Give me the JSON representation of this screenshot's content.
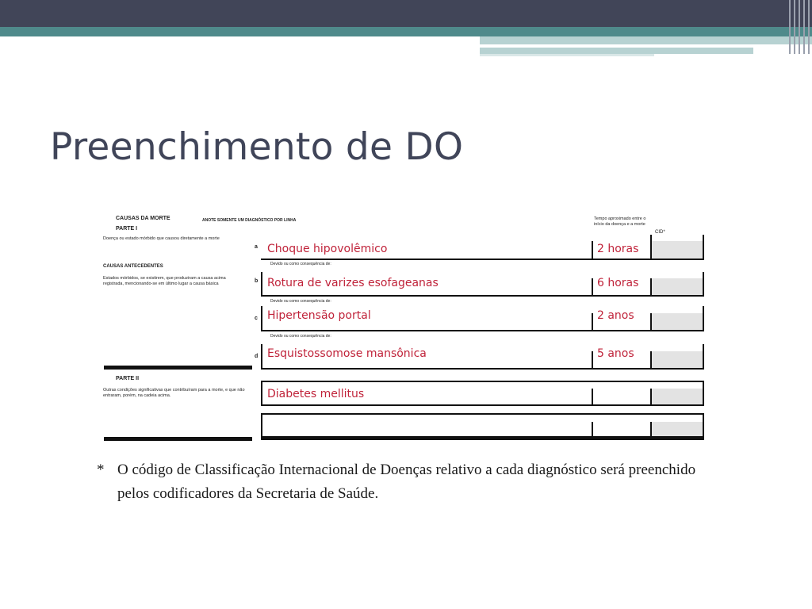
{
  "slide": {
    "title": "Preenchimento de DO"
  },
  "form": {
    "section_title": "CAUSAS DA MORTE",
    "section_note": "ANOTE SOMENTE UM DIAGNÓSTICO POR LINHA",
    "part1_label": "PARTE I",
    "part1_desc": "Doença ou estado mórbido que causou diretamente a morte",
    "antecedents_label": "CAUSAS ANTECEDENTES",
    "antecedents_desc": "Estados mórbidos, se existirem, que produziram a causa acima registrada, mencionando-se em último lugar a causa básica",
    "part2_label": "PARTE II",
    "part2_desc": "Outras condições significativas que contribuíram para a morte, e que não entraram, porém, na cadeia acima.",
    "time_header": "Tempo aproximado entre o início da doença e a morte",
    "cid_header": "CID*",
    "consequence_label": "Devido ou como consequência de:",
    "rows": [
      {
        "letter": "a",
        "diagnosis": "Choque hipovolêmico",
        "time": "2 horas"
      },
      {
        "letter": "b",
        "diagnosis": "Rotura de varizes esofageanas",
        "time": "6 horas"
      },
      {
        "letter": "c",
        "diagnosis": "Hipertensão portal",
        "time": "2 anos"
      },
      {
        "letter": "d",
        "diagnosis": "Esquistossomose mansônica",
        "time": "5 anos"
      }
    ],
    "part2_rows": [
      {
        "diagnosis": "Diabetes mellitus",
        "time": ""
      },
      {
        "diagnosis": "",
        "time": ""
      }
    ]
  },
  "footnote": {
    "marker": "*",
    "text": "O código de Classificação Internacional de Doenças relativo a cada diagnóstico será preenchido pelos codificadores da Secretaria de Saúde."
  }
}
